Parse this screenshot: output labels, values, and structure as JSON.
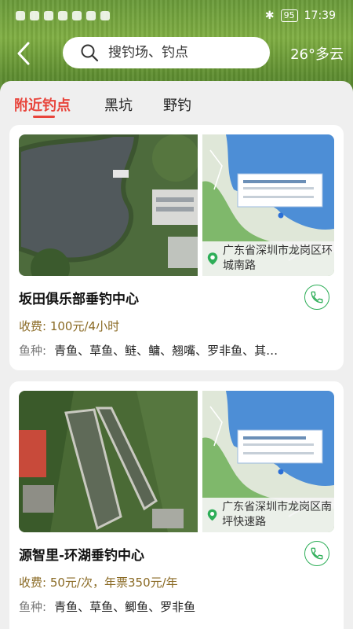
{
  "statusbar": {
    "battery": "95",
    "time": "17:39"
  },
  "search": {
    "placeholder": "搜钓场、钓点"
  },
  "weather": "26°多云",
  "tabs": [
    {
      "label": "附近钓点",
      "active": true
    },
    {
      "label": "黑坑",
      "active": false
    },
    {
      "label": "野钓",
      "active": false
    }
  ],
  "spots": [
    {
      "name": "坂田俱乐部垂钓中心",
      "fee_label": "收费:",
      "fee": "100元/4小时",
      "species_label": "鱼种:",
      "species": "青鱼、草鱼、鲢、鳙、翘嘴、罗非鱼、其…",
      "address": "广东省深圳市龙岗区环城南路"
    },
    {
      "name": "源智里-环湖垂钓中心",
      "fee_label": "收费:",
      "fee": "50元/次，年票350元/年",
      "species_label": "鱼种:",
      "species": "青鱼、草鱼、鲫鱼、罗非鱼",
      "address": "广东省深圳市龙岗区南坪快速路"
    }
  ],
  "colors": {
    "accent": "#e8453c",
    "phone_green": "#2eae58",
    "fee": "#8a6a24"
  }
}
